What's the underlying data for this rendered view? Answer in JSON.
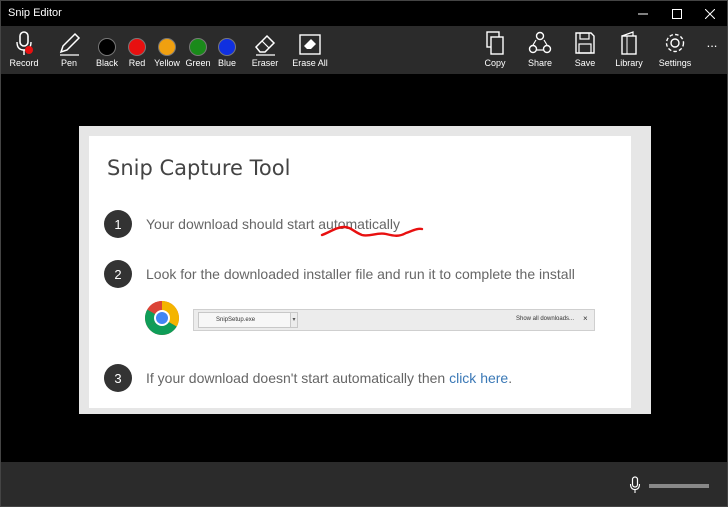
{
  "window": {
    "title": "Snip Editor"
  },
  "toolbar": {
    "record": "Record",
    "pen": "Pen",
    "colors": [
      {
        "label": "Black",
        "color": "#000000"
      },
      {
        "label": "Red",
        "color": "#e81010"
      },
      {
        "label": "Yellow",
        "color": "#f0a010"
      },
      {
        "label": "Green",
        "color": "#1a8a1a"
      },
      {
        "label": "Blue",
        "color": "#1030e0"
      }
    ],
    "eraser": "Eraser",
    "erase_all": "Erase All",
    "copy": "Copy",
    "share": "Share",
    "save": "Save",
    "library": "Library",
    "settings": "Settings",
    "more": "..."
  },
  "capture": {
    "title": "Snip Capture Tool",
    "steps": [
      {
        "num": "1",
        "text": "Your download should start automatically"
      },
      {
        "num": "2",
        "text": "Look for the downloaded installer file and run it to complete the install"
      },
      {
        "num": "3",
        "text": "If your download doesn't start automatically then ",
        "link": "click here",
        "suffix": "."
      }
    ],
    "download_bar": {
      "file": "SnipSetup.exe",
      "show_all": "Show all downloads...",
      "close": "×"
    }
  },
  "annotation": {
    "color": "#e81010"
  }
}
